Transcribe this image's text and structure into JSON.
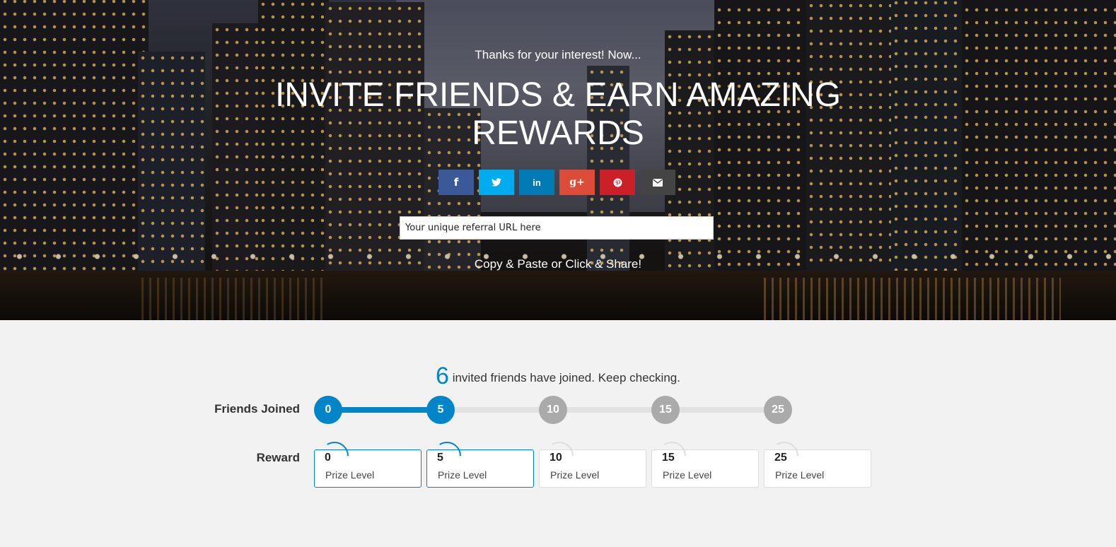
{
  "hero": {
    "subhead": "Thanks for your interest! Now...",
    "headline": "INVITE FRIENDS & EARN AMAZING REWARDS",
    "share_buttons": [
      {
        "network": "facebook",
        "icon": "facebook-icon",
        "glyph": "f",
        "color": "#3b5998"
      },
      {
        "network": "twitter",
        "icon": "twitter-icon",
        "glyph": "",
        "color": "#00aced"
      },
      {
        "network": "linkedin",
        "icon": "linkedin-icon",
        "glyph": "in",
        "color": "#007bb6"
      },
      {
        "network": "google-plus",
        "icon": "google-plus-icon",
        "glyph": "g+",
        "color": "#dd4b39"
      },
      {
        "network": "pinterest",
        "icon": "pinterest-icon",
        "glyph": "",
        "color": "#cb2027"
      },
      {
        "network": "email",
        "icon": "envelope-icon",
        "glyph": "",
        "color": "#444444"
      }
    ],
    "referral_url": {
      "value": "",
      "placeholder": "Your unique referral URL here"
    },
    "copy_text": "Copy & Paste or Click & Share!"
  },
  "progress": {
    "joined_count": "6",
    "joined_text": "invited friends have joined. Keep checking.",
    "friends_label": "Friends Joined",
    "reward_label": "Reward",
    "accent_color": "#0086c8",
    "inactive_color": "#aaaaaa",
    "steps": [
      "0",
      "5",
      "10",
      "15",
      "25"
    ],
    "steps_reached": 2,
    "progress_fraction": 0.25,
    "prizes": [
      {
        "level": "0",
        "label": "Prize Level"
      },
      {
        "level": "5",
        "label": "Prize Level"
      },
      {
        "level": "10",
        "label": "Prize Level"
      },
      {
        "level": "15",
        "label": "Prize Level"
      },
      {
        "level": "25",
        "label": "Prize Level"
      }
    ]
  }
}
